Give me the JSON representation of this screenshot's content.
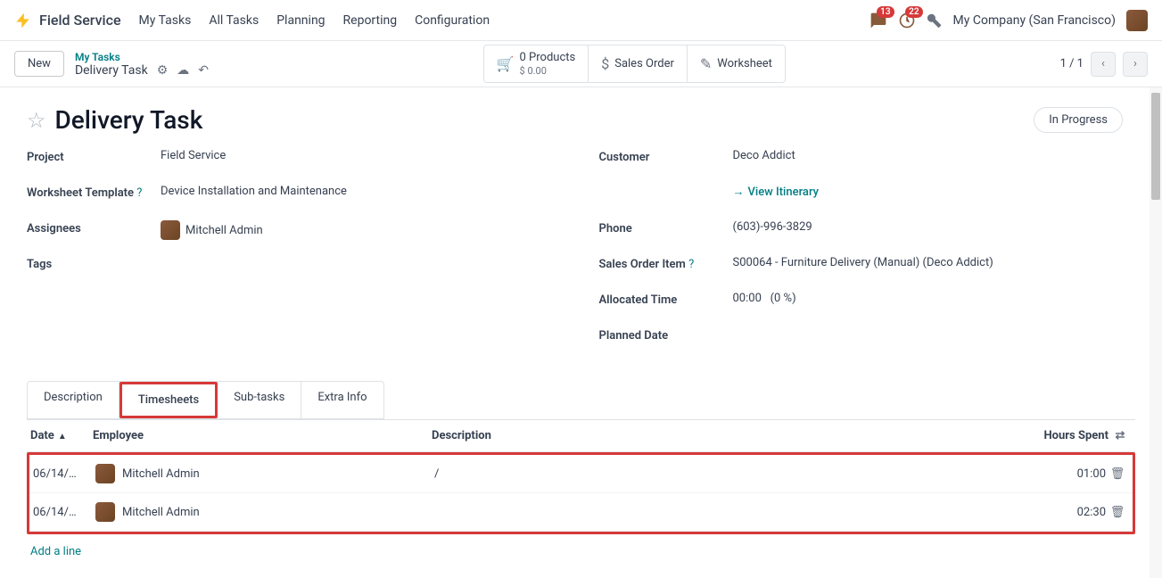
{
  "topnav": {
    "app_name": "Field Service",
    "links": [
      "My Tasks",
      "All Tasks",
      "Planning",
      "Reporting",
      "Configuration"
    ],
    "chat_count": "13",
    "clock_count": "22",
    "company": "My Company (San Francisco)"
  },
  "controlbar": {
    "new_label": "New",
    "breadcrumb_parent": "My Tasks",
    "breadcrumb_current": "Delivery Task",
    "products_line1": "0 Products",
    "products_line2": "$ 0.00",
    "sales_order_label": "Sales Order",
    "worksheet_label": "Worksheet",
    "pager_text": "1 / 1"
  },
  "form": {
    "title": "Delivery Task",
    "status": "In Progress",
    "left": {
      "project_label": "Project",
      "project_value": "Field Service",
      "wtpl_label": "Worksheet Template",
      "wtpl_value": "Device Installation and Maintenance",
      "assignees_label": "Assignees",
      "assignee_name": "Mitchell Admin",
      "tags_label": "Tags"
    },
    "right": {
      "customer_label": "Customer",
      "customer_value": "Deco Addict",
      "view_itinerary": "View Itinerary",
      "phone_label": "Phone",
      "phone_value": "(603)-996-3829",
      "soitem_label": "Sales Order Item",
      "soitem_value": "S00064 - Furniture Delivery (Manual) (Deco Addict)",
      "alloc_label": "Allocated Time",
      "alloc_time": "00:00",
      "alloc_pct": "(0 %)",
      "planned_label": "Planned Date"
    }
  },
  "tabs": [
    "Description",
    "Timesheets",
    "Sub-tasks",
    "Extra Info"
  ],
  "timesheets": {
    "head_date": "Date",
    "head_employee": "Employee",
    "head_description": "Description",
    "head_hours": "Hours Spent",
    "rows": [
      {
        "date": "06/14/…",
        "employee": "Mitchell Admin",
        "description": "/",
        "hours": "01:00"
      },
      {
        "date": "06/14/…",
        "employee": "Mitchell Admin",
        "description": "",
        "hours": "02:30"
      }
    ],
    "add_line": "Add a line"
  }
}
